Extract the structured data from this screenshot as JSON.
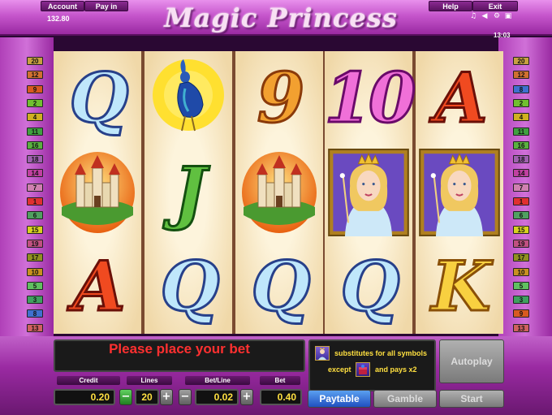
{
  "header": {
    "account_label": "Account",
    "payin_label": "Pay in",
    "help_label": "Help",
    "exit_label": "Exit",
    "balance": "132.80",
    "clock": "13:03",
    "logo": "Magic Princess",
    "icons": [
      "music-note-icon",
      "sound-icon",
      "settings-icon",
      "fullscreen-icon"
    ]
  },
  "paylines": {
    "left": [
      "20",
      "12",
      "9",
      "2",
      "4",
      "11",
      "16",
      "18",
      "14",
      "7",
      "1",
      "6",
      "15",
      "19",
      "17",
      "10",
      "5",
      "3",
      "8",
      "13"
    ],
    "right": [
      "20",
      "12",
      "8",
      "2",
      "4",
      "11",
      "16",
      "18",
      "14",
      "7",
      "1",
      "6",
      "15",
      "19",
      "17",
      "10",
      "5",
      "3",
      "9",
      "13"
    ],
    "colors": {
      "20": "#c8a040",
      "12": "#d07030",
      "9": "#d85a20",
      "2": "#70c030",
      "4": "#d0b020",
      "11": "#40a040",
      "16": "#5ab040",
      "18": "#a060b0",
      "14": "#c040a0",
      "7": "#d080b0",
      "1": "#e03030",
      "6": "#50a060",
      "15": "#d8d020",
      "19": "#c05080",
      "17": "#909020",
      "10": "#c89020",
      "5": "#60c060",
      "3": "#40a060",
      "8": "#4070d0",
      "13": "#d06060"
    }
  },
  "reels": [
    [
      {
        "kind": "glyph",
        "text": "Q",
        "style": "blue"
      },
      {
        "kind": "castle"
      },
      {
        "kind": "glyph",
        "text": "A",
        "style": "red"
      }
    ],
    [
      {
        "kind": "peacock"
      },
      {
        "kind": "glyph",
        "text": "J",
        "style": "green"
      },
      {
        "kind": "glyph",
        "text": "Q",
        "style": "blue"
      }
    ],
    [
      {
        "kind": "glyph",
        "text": "9",
        "style": "orange"
      },
      {
        "kind": "castle"
      },
      {
        "kind": "glyph",
        "text": "Q",
        "style": "blue"
      }
    ],
    [
      {
        "kind": "glyph",
        "text": "10",
        "style": "pink"
      },
      {
        "kind": "princess"
      },
      {
        "kind": "glyph",
        "text": "Q",
        "style": "blue"
      }
    ],
    [
      {
        "kind": "glyph",
        "text": "A",
        "style": "red"
      },
      {
        "kind": "princess"
      },
      {
        "kind": "glyph",
        "text": "K",
        "style": "yellow"
      }
    ]
  ],
  "message": "Please place your bet",
  "info": {
    "line1": "substitutes for all symbols",
    "line2_a": "except",
    "line2_b": "and pays x2"
  },
  "controls": {
    "credit_label": "Credit",
    "credit_value": "0.20",
    "lines_label": "Lines",
    "lines_value": "20",
    "betline_label": "Bet/Line",
    "betline_value": "0.02",
    "bet_label": "Bet",
    "bet_value": "0.40",
    "minus": "−",
    "plus": "+",
    "paytable_label": "Paytable",
    "gamble_label": "Gamble",
    "start_label": "Start",
    "autoplay_label": "Autoplay"
  }
}
